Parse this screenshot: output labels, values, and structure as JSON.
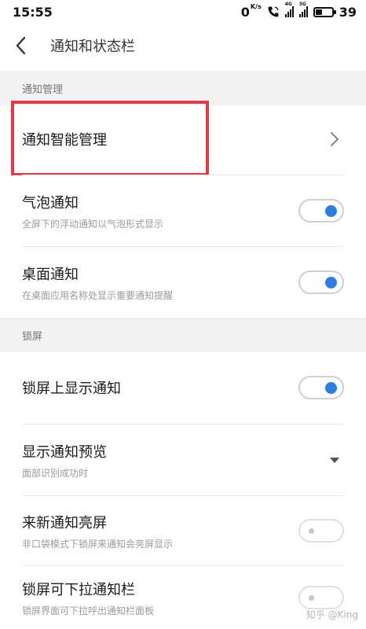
{
  "status_bar": {
    "time": "15:55",
    "net_speed": "0",
    "net_speed_unit": "K/s",
    "sim1_tag": "4G",
    "sim2_tag": "3G",
    "battery": "39",
    "battery_fraction": 0.39
  },
  "header": {
    "title": "通知和状态栏"
  },
  "sections": [
    {
      "label": "通知管理"
    },
    {
      "label": "锁屏"
    }
  ],
  "rows": {
    "smart": {
      "title": "通知智能管理"
    },
    "bubble": {
      "title": "气泡通知",
      "subtitle": "全屏下的浮动通知以气泡形式显示",
      "enabled": true
    },
    "desktop": {
      "title": "桌面通知",
      "subtitle": "在桌面应用名称处显示重要通知提醒",
      "enabled": true
    },
    "lock_show": {
      "title": "锁屏上显示通知",
      "enabled": true
    },
    "preview": {
      "title": "显示通知预览",
      "subtitle": "面部识别成功时"
    },
    "wake": {
      "title": "来新通知亮屏",
      "subtitle": "非口袋模式下锁屏来通知会亮屏显示",
      "enabled": false
    },
    "pulldown": {
      "title": "锁屏可下拉通知栏",
      "subtitle": "锁屏界面可下拉呼出通知栏面板",
      "enabled": false
    }
  },
  "watermark": "知乎 @King",
  "colors": {
    "accent": "#2f7de1",
    "highlight": "#e23b4b",
    "section_bg": "#f2f2f2"
  },
  "icons": [
    "back-arrow-icon",
    "chevron-right-icon",
    "dropdown-caret-icon",
    "phone-call-icon",
    "signal-icon",
    "battery-icon"
  ]
}
